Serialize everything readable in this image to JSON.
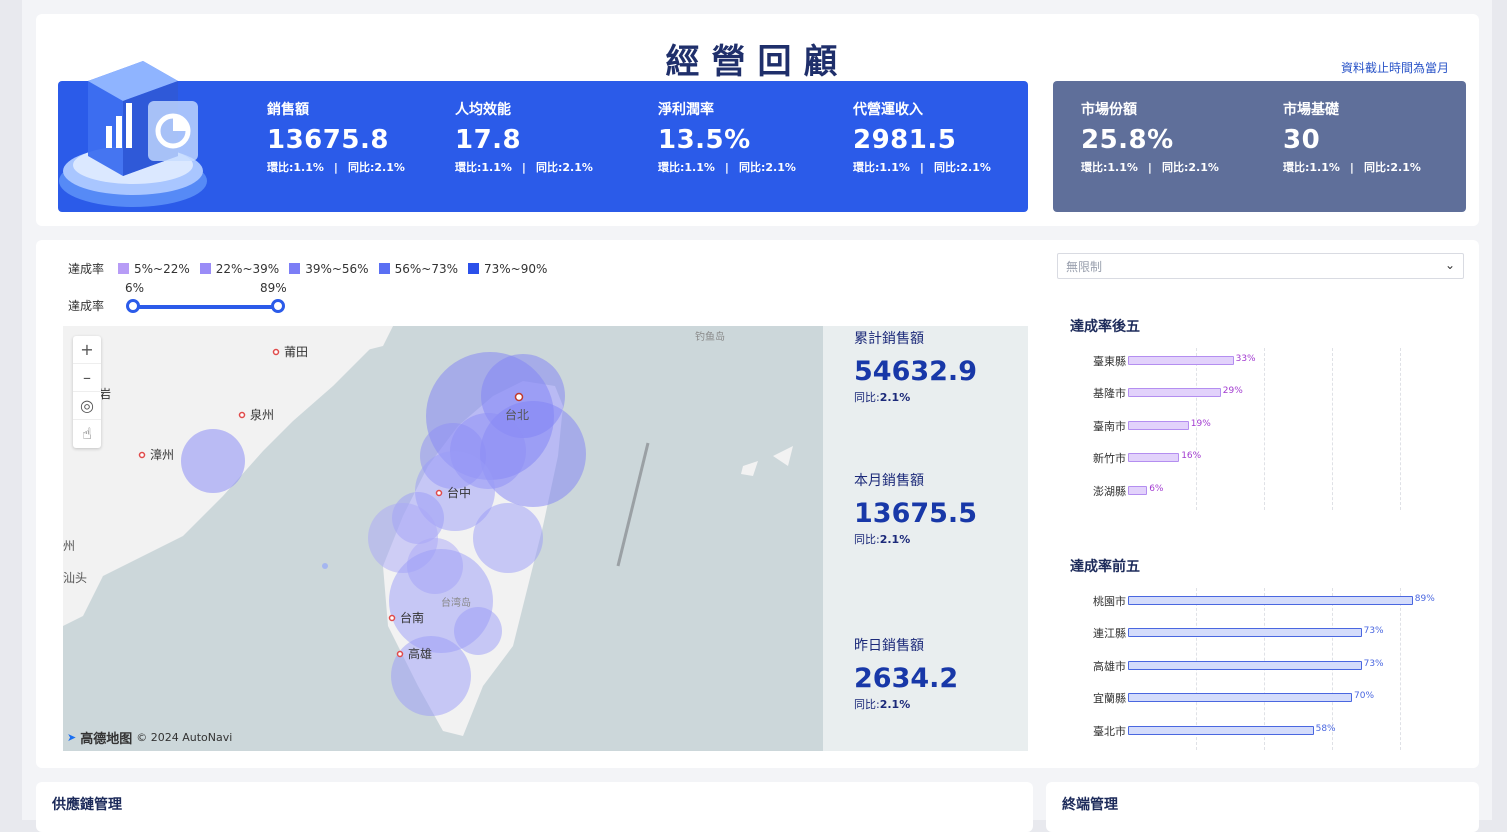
{
  "header": {
    "title": "經營回顧",
    "as_of": "資料截止時間為當月"
  },
  "kpis_primary": [
    {
      "label": "銷售額",
      "value": "13675.8",
      "mom_label": "環比:",
      "mom": "1.1%",
      "yoy_label": "同比:",
      "yoy": "2.1%"
    },
    {
      "label": "人均效能",
      "value": "17.8",
      "mom_label": "環比:",
      "mom": "1.1%",
      "yoy_label": "同比:",
      "yoy": "2.1%"
    },
    {
      "label": "淨利潤率",
      "value": "13.5%",
      "mom_label": "環比:",
      "mom": "1.1%",
      "yoy_label": "同比:",
      "yoy": "2.1%"
    },
    {
      "label": "代營運收入",
      "value": "2981.5",
      "mom_label": "環比:",
      "mom": "1.1%",
      "yoy_label": "同比:",
      "yoy": "2.1%"
    }
  ],
  "kpis_secondary": [
    {
      "label": "市場份額",
      "value": "25.8%",
      "mom_label": "環比:",
      "mom": "1.1%",
      "yoy_label": "同比:",
      "yoy": "2.1%"
    },
    {
      "label": "市場基礎",
      "value": "30",
      "mom_label": "環比:",
      "mom": "1.1%",
      "yoy_label": "同比:",
      "yoy": "2.1%"
    }
  ],
  "legend": {
    "title": "達成率",
    "items": [
      {
        "label": "5%~22%",
        "color": "#b79cf6"
      },
      {
        "label": "22%~39%",
        "color": "#9a8cf7"
      },
      {
        "label": "39%~56%",
        "color": "#7c7ef6"
      },
      {
        "label": "56%~73%",
        "color": "#5a6ff3"
      },
      {
        "label": "73%~90%",
        "color": "#2b50ea"
      }
    ]
  },
  "range_slider": {
    "title": "達成率",
    "min_label": "6%",
    "max_label": "89%",
    "min": 6,
    "max": 89
  },
  "map": {
    "zoom_in": "+",
    "zoom_out": "–",
    "places": [
      "莆田",
      "泉州",
      "漳州",
      "龙岩",
      "台北",
      "台中",
      "台南",
      "高雄",
      "台湾岛",
      "钓鱼岛",
      "州",
      "汕头"
    ],
    "attribution_brand": "高德地图",
    "attribution": "© 2024 AutoNavi"
  },
  "stats": [
    {
      "label": "累計銷售額",
      "value": "54632.9",
      "yoy_label": "同比:",
      "yoy": "2.1%"
    },
    {
      "label": "本月銷售額",
      "value": "13675.5",
      "yoy_label": "同比:",
      "yoy": "2.1%"
    },
    {
      "label": "昨日銷售額",
      "value": "2634.2",
      "yoy_label": "同比:",
      "yoy": "2.1%"
    }
  ],
  "filter": {
    "value": "無限制"
  },
  "bottom5": {
    "title": "達成率後五",
    "color": "#e2d2fb",
    "border": "#b48ef0",
    "text_color": "#a23bd0",
    "rows": [
      {
        "name": "臺東縣",
        "pct_label": "33%",
        "value": 33
      },
      {
        "name": "基隆市",
        "pct_label": "29%",
        "value": 29
      },
      {
        "name": "臺南市",
        "pct_label": "19%",
        "value": 19
      },
      {
        "name": "新竹市",
        "pct_label": "16%",
        "value": 16
      },
      {
        "name": "澎湖縣",
        "pct_label": "6%",
        "value": 6
      }
    ]
  },
  "top5": {
    "title": "達成率前五",
    "color": "#d4dcfb",
    "border": "#4a67e0",
    "text_color": "#4a67e0",
    "rows": [
      {
        "name": "桃園市",
        "pct_label": "89%",
        "value": 89
      },
      {
        "name": "連江縣",
        "pct_label": "73%",
        "value": 73
      },
      {
        "name": "高雄市",
        "pct_label": "73%",
        "value": 73
      },
      {
        "name": "宜蘭縣",
        "pct_label": "70%",
        "value": 70
      },
      {
        "name": "臺北市",
        "pct_label": "58%",
        "value": 58
      }
    ]
  },
  "sections": {
    "supply_chain": "供應鏈管理",
    "terminal": "終端管理"
  }
}
